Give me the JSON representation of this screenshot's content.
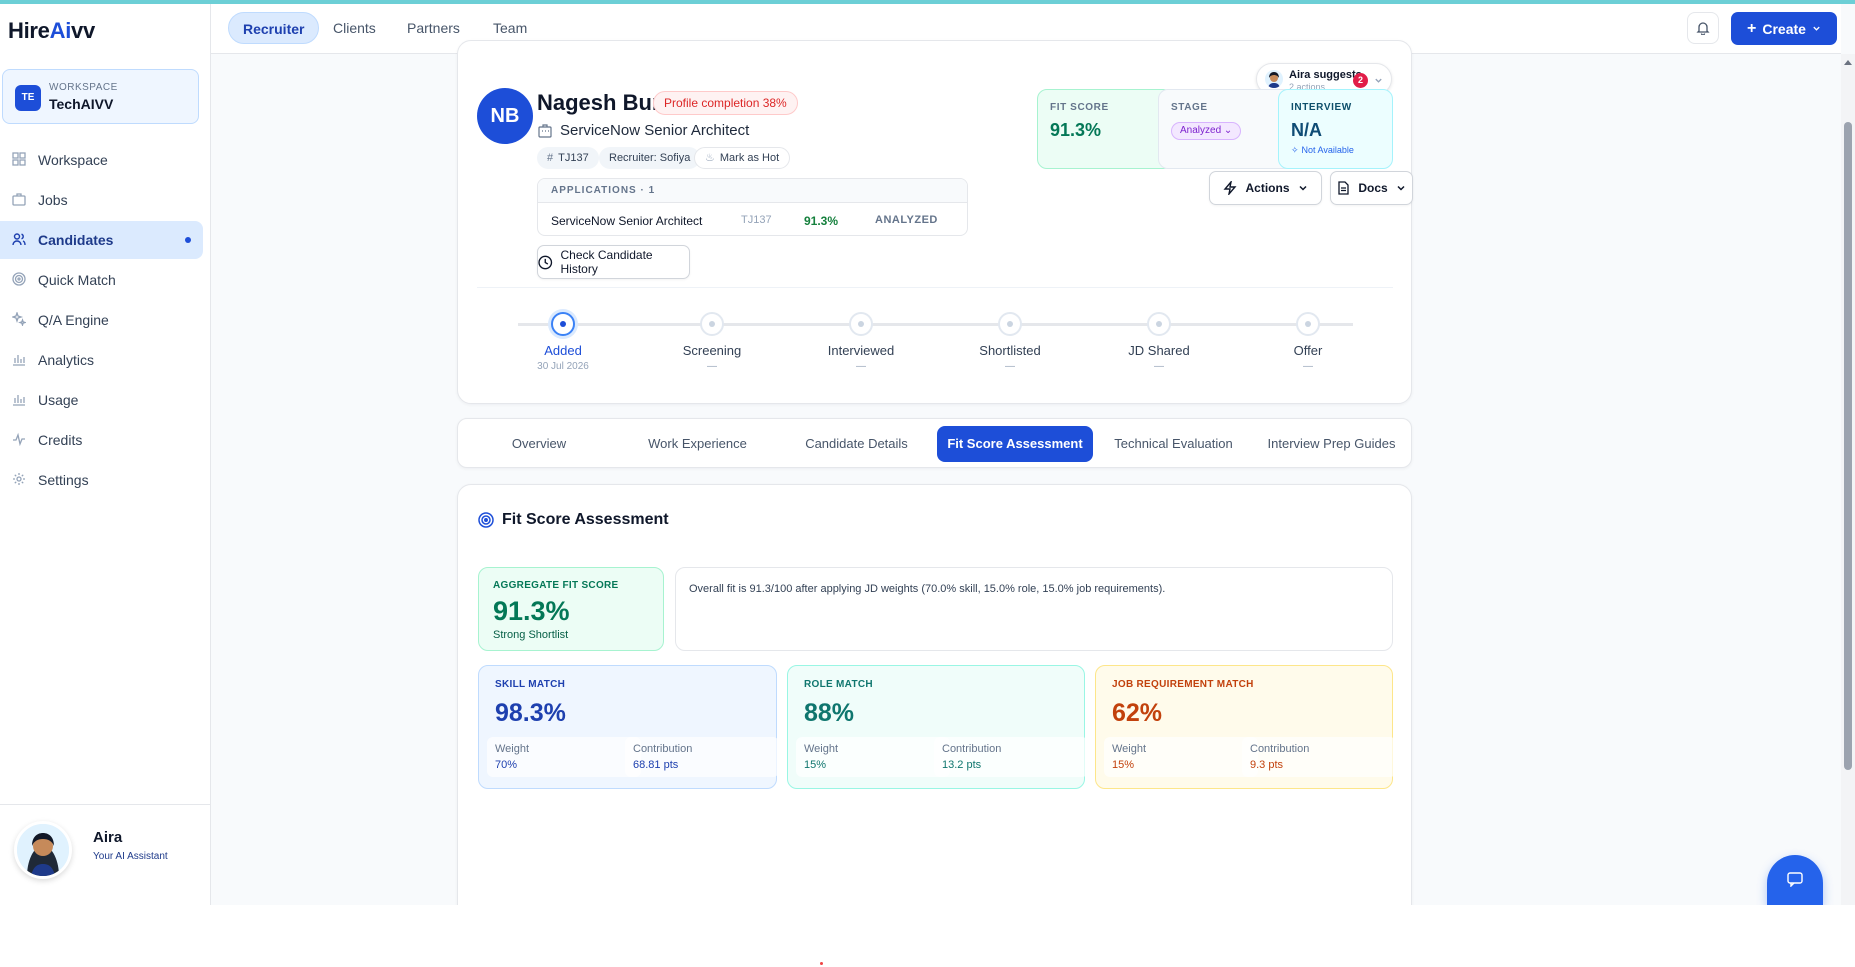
{
  "brand": {
    "pre": "Hire",
    "ai": "Ai",
    "post": "vv"
  },
  "workspace": {
    "badge": "TE",
    "label": "WORKSPACE",
    "name": "TechAIVV"
  },
  "nav": [
    {
      "label": "Workspace",
      "icon": "grid-icon"
    },
    {
      "label": "Jobs",
      "icon": "briefcase-icon"
    },
    {
      "label": "Candidates",
      "icon": "users-icon",
      "active": true
    },
    {
      "label": "Quick Match",
      "icon": "target-icon"
    },
    {
      "label": "Q/A Engine",
      "icon": "sparkle-icon"
    },
    {
      "label": "Analytics",
      "icon": "bar-chart-icon"
    },
    {
      "label": "Usage",
      "icon": "bar-chart-icon"
    },
    {
      "label": "Credits",
      "icon": "activity-icon"
    },
    {
      "label": "Settings",
      "icon": "gear-icon"
    }
  ],
  "assistant": {
    "name": "Aira",
    "subtitle": "Your AI Assistant"
  },
  "top_tabs": [
    "Recruiter",
    "Clients",
    "Partners",
    "Team"
  ],
  "create_label": "Create",
  "candidate": {
    "initials": "NB",
    "name": "Nagesh Bura",
    "profile_completion": "Profile completion 38%",
    "title": "ServiceNow Senior Architect",
    "id": "TJ137",
    "recruiter": "Recruiter: Sofiya",
    "mark_hot": "Mark as Hot"
  },
  "applications": {
    "header": "APPLICATIONS · 1",
    "rows": [
      {
        "title": "ServiceNow Senior Architect",
        "id": "TJ137",
        "score": "91.3%",
        "status": "ANALYZED"
      }
    ]
  },
  "history_button": "Check Candidate History",
  "suggest": {
    "title": "Aira suggests",
    "sub": "2 actions",
    "count": "2"
  },
  "stats": {
    "fit": {
      "label": "FIT SCORE",
      "value": "91.3%"
    },
    "stage": {
      "label": "STAGE",
      "value": "Analyzed"
    },
    "interview": {
      "label": "INTERVIEW",
      "value": "N/A",
      "note": "Not Available"
    }
  },
  "actions_label": "Actions",
  "docs_label": "Docs",
  "timeline": [
    {
      "name": "Added",
      "date": "30 Jul 2026",
      "active": true
    },
    {
      "name": "Screening",
      "date": "—"
    },
    {
      "name": "Interviewed",
      "date": "—"
    },
    {
      "name": "Shortlisted",
      "date": "—"
    },
    {
      "name": "JD Shared",
      "date": "—"
    },
    {
      "name": "Offer",
      "date": "—"
    }
  ],
  "tabs": [
    "Overview",
    "Work Experience",
    "Candidate Details",
    "Fit Score Assessment",
    "Technical Evaluation",
    "Interview Prep Guides"
  ],
  "active_tab": "Fit Score Assessment",
  "assessment": {
    "title": "Fit Score Assessment",
    "aggregate": {
      "label": "AGGREGATE FIT SCORE",
      "value": "91.3%",
      "verdict": "Strong Shortlist"
    },
    "summary": "Overall fit is 91.3/100 after applying JD weights (70.0% skill, 15.0% role, 15.0% job requirements).",
    "matches": [
      {
        "label": "SKILL MATCH",
        "value": "98.3%",
        "weight_label": "Weight",
        "weight": "70%",
        "contribution_label": "Contribution",
        "contribution": "68.81 pts",
        "color": "#1e40af"
      },
      {
        "label": "ROLE MATCH",
        "value": "88%",
        "weight_label": "Weight",
        "weight": "15%",
        "contribution_label": "Contribution",
        "contribution": "13.2 pts",
        "color": "#0f766e"
      },
      {
        "label": "JOB REQUIREMENT MATCH",
        "value": "62%",
        "weight_label": "Weight",
        "weight": "15%",
        "contribution_label": "Contribution",
        "contribution": "9.3 pts",
        "color": "#c2410c"
      }
    ]
  }
}
